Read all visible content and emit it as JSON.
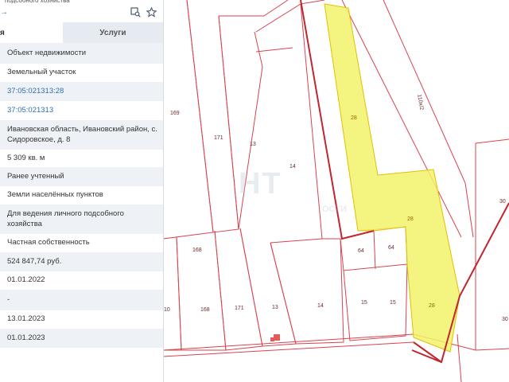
{
  "panel": {
    "subtitle": "подсобного хозяйства",
    "back_arrow": "→",
    "tabs": [
      {
        "label": "я"
      },
      {
        "label": "Услуги"
      }
    ],
    "rows": [
      {
        "text": "Объект недвижимости"
      },
      {
        "text": "Земельный участок"
      },
      {
        "text": "37:05:021313:28"
      },
      {
        "text": "37:05:021313"
      },
      {
        "text": "Ивановская область, Ивановский район, с. Сидоровское, д. 8"
      },
      {
        "text": "5 309 кв. м"
      },
      {
        "text": "Ранее учтенный"
      },
      {
        "text": "Земли населённых пунктов"
      },
      {
        "text": "Для ведения личного подсобного хозяйства"
      },
      {
        "text": "Частная собственность"
      },
      {
        "text": "524 847,74 руб."
      },
      {
        "text": "01.01.2022"
      },
      {
        "text": "-"
      },
      {
        "text": "13.01.2023"
      },
      {
        "text": "01.01.2023"
      }
    ],
    "icons": [
      "map-search-icon",
      "star-icon"
    ]
  },
  "map": {
    "labels": {
      "p169": "169",
      "p171a": "171",
      "p13a": "13",
      "p14a": "14",
      "p28a": "28",
      "p28b": "28",
      "p28c": "28",
      "p64a": "64",
      "p64b": "64",
      "p168a": "168",
      "p168b": "168",
      "p171b": "171",
      "p13b": "13",
      "p14b": "14",
      "p15a": "15",
      "p15b": "15",
      "p10": "10",
      "p30a": "30",
      "p30b": "30",
      "road": "110к/2"
    },
    "colors": {
      "boundary": "#d9434f",
      "selected_fill": "#f2f26b",
      "selected_edge": "#c0262e"
    }
  }
}
